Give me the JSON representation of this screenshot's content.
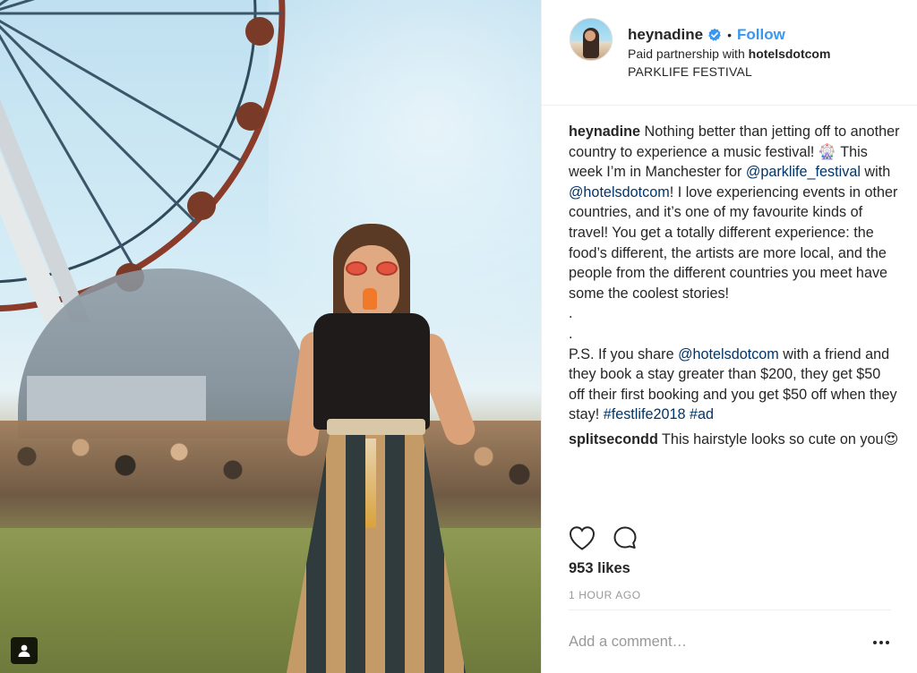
{
  "photo": {
    "description_icon": "user-tag-icon"
  },
  "header": {
    "username": "heynadine",
    "verified_icon": "verified-badge-icon",
    "separator": "•",
    "follow_label": "Follow",
    "partnership_prefix": "Paid partnership with",
    "partner": "hotelsdotcom",
    "location": "PARKLIFE FESTIVAL"
  },
  "caption": {
    "author": "heynadine",
    "text1": " Nothing better than jetting off to another country to experience a music festival! 🎡  This week I’m in Manchester for ",
    "mention1": "@parklife_festival",
    "text2": " with ",
    "mention2": "@hotelsdotcom",
    "text3": "! I love experiencing events in other countries, and it’s one of my favourite kinds of travel! You get a totally different experience: the food’s different, the artists are more local, and the people from the different countries you meet have some the coolest stories!",
    "dot1": ".",
    "dot2": ".",
    "ps_text1": "P.S. If you share ",
    "mention3": "@hotelsdotcom",
    "ps_text2": " with a friend and they book a stay greater than $200, they get $50 off their first booking and you get $50 off when they stay!",
    "hashtag1": "#festlife2018",
    "hashtag2": "#ad"
  },
  "comment": {
    "author": "splitsecondd",
    "text": " This hairstyle looks so cute on you😍"
  },
  "actions": {
    "like_icon": "heart-icon",
    "comment_icon": "comment-icon"
  },
  "likes": "953 likes",
  "timestamp": "1 HOUR AGO",
  "add_comment": {
    "placeholder": "Add a comment…"
  },
  "more_icon": "more-options-icon",
  "colors": {
    "link": "#3897f0",
    "mention": "#003569",
    "muted": "#999999",
    "text": "#262626"
  }
}
